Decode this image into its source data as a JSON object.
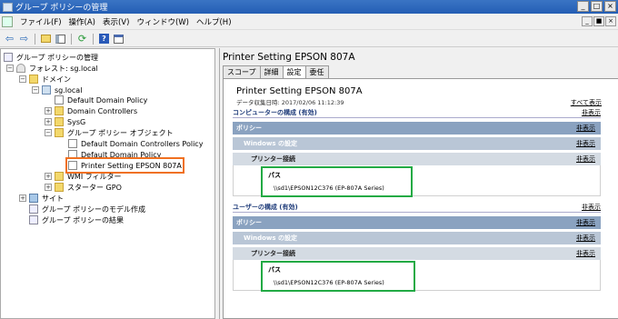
{
  "window": {
    "title": "グループ ポリシーの管理",
    "controls": [
      "_",
      "□",
      "×"
    ]
  },
  "menubar": {
    "items": [
      "ファイル(F)",
      "操作(A)",
      "表示(V)",
      "ウィンドウ(W)",
      "ヘルプ(H)"
    ],
    "mdi_controls": [
      "_",
      "■",
      "×"
    ]
  },
  "toolbar": {
    "icons": [
      "back-icon",
      "forward-icon",
      "up-folder-icon",
      "show-hide-tree-icon",
      "refresh-icon",
      "help-icon",
      "properties-icon"
    ]
  },
  "tree": {
    "root": "グループ ポリシーの管理",
    "forest": "フォレスト: sg.local",
    "domains": "ドメイン",
    "domain": "sg.local",
    "default_domain_policy": "Default Domain Policy",
    "domain_controllers": "Domain Controllers",
    "sysg": "SysG",
    "gpo_objects": "グループ ポリシー オブジェクト",
    "gpo_ddcp": "Default Domain Controllers Policy",
    "gpo_ddp": "Default Domain Policy",
    "gpo_printer": "Printer Setting EPSON 807A",
    "wmi_filters": "WMI フィルター",
    "starter_gpo": "スターター GPO",
    "sites": "サイト",
    "modeling": "グループ ポリシーのモデル作成",
    "results": "グループ ポリシーの結果"
  },
  "right": {
    "title": "Printer Setting EPSON 807A",
    "tabs": [
      "スコープ",
      "詳細",
      "設定",
      "委任"
    ],
    "active_tab": "設定"
  },
  "report": {
    "title": "Printer Setting EPSON 807A",
    "collected": "データ収集日時: 2017/02/06 11:12:39",
    "show_all": "すべて表示",
    "hide": "非表示",
    "computer_section": "コンピューターの構成 (有効)",
    "user_section": "ユーザーの構成 (有効)",
    "policies": "ポリシー",
    "windows_settings": "Windows の設定",
    "printer_connections": "プリンター接続",
    "path_label": "パス",
    "path_value": "\\\\sd1\\EPSON12C376 (EP-807A Series)"
  },
  "colors": {
    "selection_outline": "#f07020",
    "highlight_box": "#22aa44",
    "bar_policy": "#8aa2c0",
    "bar_windows": "#b9c6d6",
    "bar_printer": "#d4dbe3"
  }
}
